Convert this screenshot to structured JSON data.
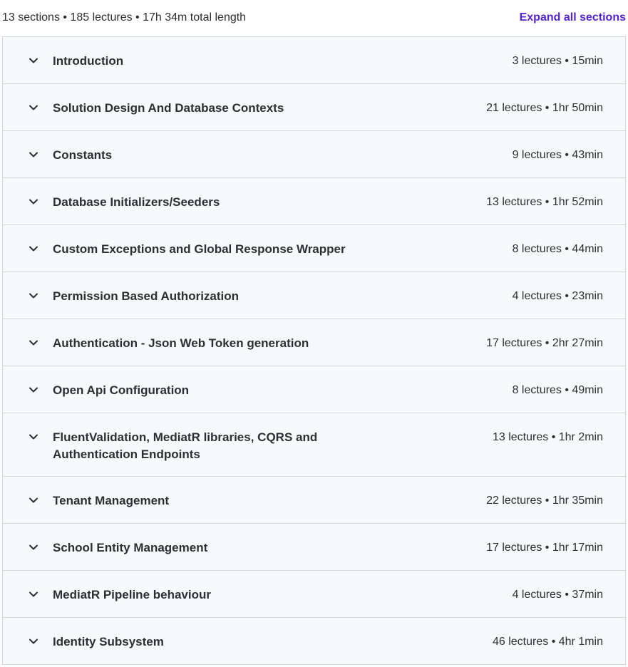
{
  "summary": "13 sections • 185 lectures • 17h 34m total length",
  "expand_all_label": "Expand all sections",
  "chevron_icon": "chevron-down-icon",
  "sections": [
    {
      "title": "Introduction",
      "meta": "3 lectures • 15min"
    },
    {
      "title": "Solution Design And Database Contexts",
      "meta": "21 lectures • 1hr 50min"
    },
    {
      "title": "Constants",
      "meta": "9 lectures • 43min"
    },
    {
      "title": "Database Initializers/Seeders",
      "meta": "13 lectures • 1hr 52min"
    },
    {
      "title": "Custom Exceptions and Global Response Wrapper",
      "meta": "8 lectures • 44min"
    },
    {
      "title": "Permission Based Authorization",
      "meta": "4 lectures • 23min"
    },
    {
      "title": "Authentication - Json Web Token generation",
      "meta": "17 lectures • 2hr 27min"
    },
    {
      "title": "Open Api Configuration",
      "meta": "8 lectures • 49min"
    },
    {
      "title": "FluentValidation, MediatR libraries, CQRS and Authentication Endpoints",
      "meta": "13 lectures • 1hr 2min"
    },
    {
      "title": "Tenant Management",
      "meta": "22 lectures • 1hr 35min"
    },
    {
      "title": "School Entity Management",
      "meta": "17 lectures • 1hr 17min"
    },
    {
      "title": "MediatR Pipeline behaviour",
      "meta": "4 lectures • 37min"
    },
    {
      "title": "Identity Subsystem",
      "meta": "46 lectures • 4hr 1min"
    }
  ]
}
